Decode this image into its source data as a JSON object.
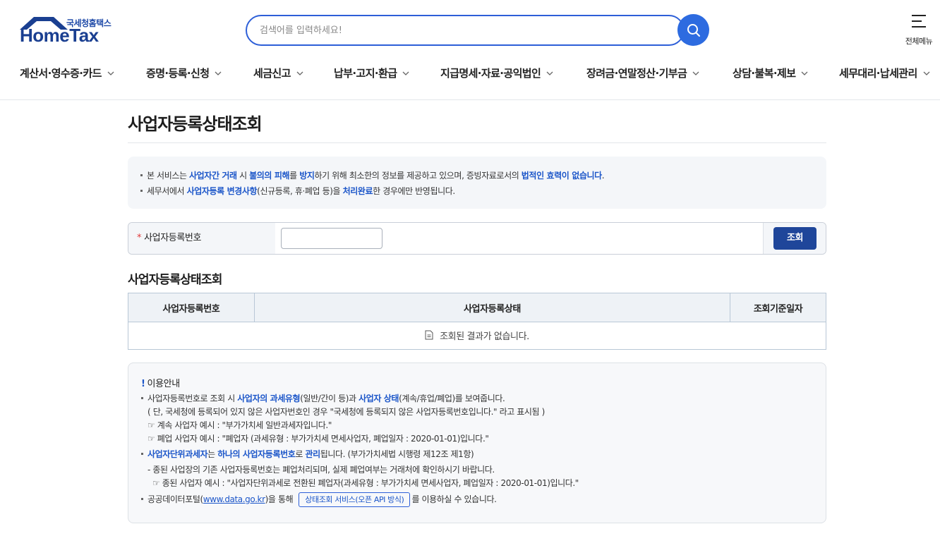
{
  "header": {
    "logo_small": "국세청홈택스",
    "logo_big": "HomeTax",
    "search_placeholder": "검색어를 입력하세요!",
    "all_menu_label": "전체메뉴",
    "icons": {
      "search": "search-icon",
      "menu": "hamburger-menu-icon",
      "chevron": "chevron-down-icon"
    },
    "colors": {
      "brand": "#1a3f91",
      "accent": "#2d6be0"
    }
  },
  "gnb": [
    "계산서·영수증·카드",
    "증명·등록·신청",
    "세금신고",
    "납부·고지·환급",
    "지급명세·자료·공익법인",
    "장려금·연말정산·기부금",
    "상담·불복·제보",
    "세무대리·납세관리"
  ],
  "page": {
    "title": "사업자등록상태조회",
    "notice": {
      "line1": [
        "본 서비스는 ",
        "사업자간 거래",
        " 시 ",
        "불의의 피해",
        "를 ",
        "방지",
        "하기 위해 최소한의 정보를 제공하고 있으며, 증빙자료로서의 ",
        "법적인 효력이 없습니다",
        "."
      ],
      "line2": [
        "세무서에서 ",
        "사업자등록 변경사항",
        "(신규등록, 휴·폐업 등)을 ",
        "처리완료",
        "한 경우에만 반영됩니다."
      ]
    },
    "form": {
      "required_mark": "*",
      "label": "사업자등록번호",
      "input_value": "",
      "submit": "조회"
    },
    "result": {
      "title": "사업자등록상태조회",
      "columns": [
        "사업자등록번호",
        "사업자등록상태",
        "조회기준일자"
      ],
      "empty_message": "조회된 결과가 없습니다."
    },
    "guide": {
      "mark": "!",
      "title": "이용안내",
      "l1": [
        "사업자등록번호로 조회 시 ",
        "사업자의 과세유형",
        "(일반/간이 등)과 ",
        "사업자 상태",
        "(계속/휴업/폐업)를 보여줍니다."
      ],
      "l2": "( 단, 국세청에 등록되어 있지 않은 사업자번호인 경우 \"국세청에 등록되지 않은 사업자등록번호입니다.\" 라고 표시됨 )",
      "l3": "☞ 계속 사업자 예시 : \"부가가치세 일반과세자입니다.\"",
      "l4": "☞ 폐업 사업자 예시 : \"폐업자 (과세유형 : 부가가치세 면세사업자, 폐업일자 : 2020-01-01)입니다.\"",
      "l5": [
        "사업자단위과세자",
        "는 ",
        "하나의 사업자등록번호",
        "로 ",
        "관리",
        "됩니다. (부가가치세법 시행령 제12조 제1항)"
      ],
      "l6": "- 종된 사업장의 기존 사업자등록번호는 폐업처리되며, 실제 폐업여부는 거래처에 확인하시기 바랍니다.",
      "l7": "☞ 종된 사업자 예시 : \"사업자단위과세로 전환된 폐업자(과세유형 : 부가가치세 면세사업자, 폐업일자 : 2020-01-01)입니다.\"",
      "l8_prefix": "공공데이터포털(",
      "l8_link": "www.data.go.kr",
      "l8_mid": ")을 통해",
      "l8_button": "상태조회 서비스(오픈 API 방식)",
      "l8_suffix": "를 이용하실 수 있습니다."
    }
  }
}
